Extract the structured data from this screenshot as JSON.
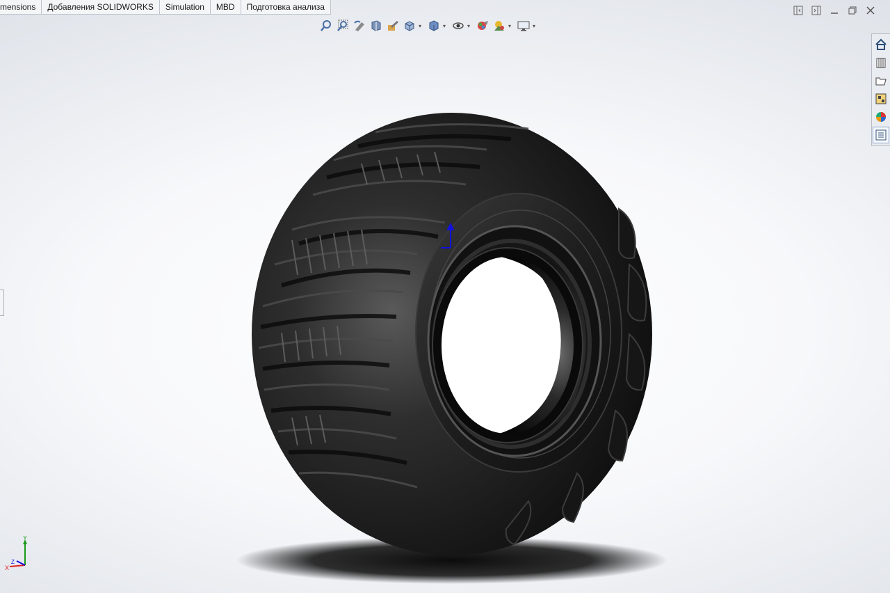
{
  "tabs": [
    {
      "label": "mensions"
    },
    {
      "label": "Добавления SOLIDWORKS"
    },
    {
      "label": "Simulation"
    },
    {
      "label": "MBD"
    },
    {
      "label": "Подготовка анализа"
    }
  ],
  "view_toolbar": [
    {
      "icon": "zoom-to-fit-icon"
    },
    {
      "icon": "zoom-to-area-icon"
    },
    {
      "icon": "previous-view-icon"
    },
    {
      "icon": "section-view-icon"
    },
    {
      "icon": "dynamic-annotation-icon"
    },
    {
      "icon": "view-orientation-icon"
    },
    {
      "icon": "display-style-icon"
    },
    {
      "icon": "hide-show-items-icon"
    },
    {
      "icon": "edit-appearance-icon"
    },
    {
      "icon": "apply-scene-icon"
    },
    {
      "icon": "view-settings-icon"
    }
  ],
  "task_pane": [
    {
      "icon": "solidworks-resources-icon"
    },
    {
      "icon": "design-library-icon"
    },
    {
      "icon": "file-explorer-icon"
    },
    {
      "icon": "view-palette-icon"
    },
    {
      "icon": "appearances-scenes-icon"
    },
    {
      "icon": "custom-properties-icon"
    }
  ],
  "triad": {
    "x_label": "X",
    "y_label": "Y",
    "z_label": "Z"
  },
  "colors": {
    "tire": "#1c1c1c",
    "axis_x": "#e02020",
    "axis_y": "#1a9a1a",
    "axis_z": "#1010e0"
  }
}
